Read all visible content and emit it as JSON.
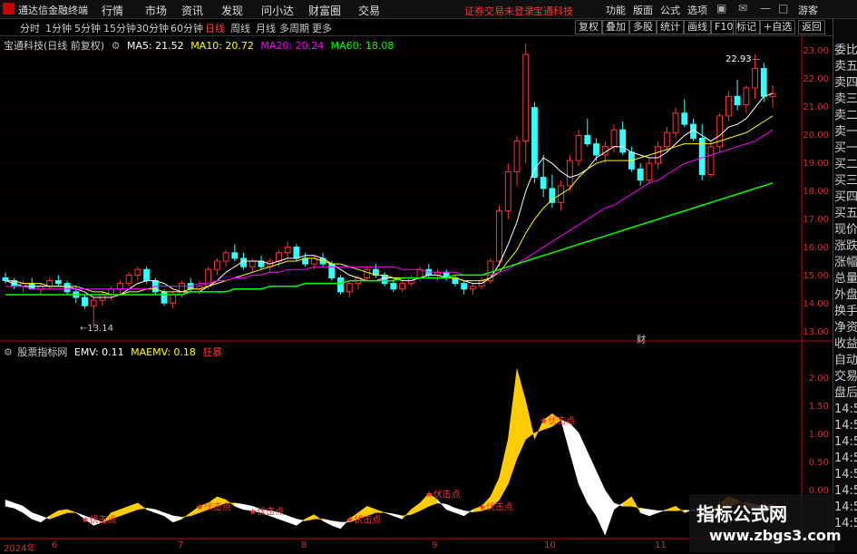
{
  "menubar": {
    "app_title": "通达信金融终端",
    "menu": [
      "行情",
      "市场",
      "资讯",
      "发现",
      "问小达",
      "财富圈",
      "交易"
    ],
    "notice": "证券交易未登录",
    "stock": "宝通科技",
    "right": [
      "功能",
      "版面",
      "公式",
      "选项"
    ],
    "user": "游客"
  },
  "tabs": {
    "periods": [
      "分时",
      "1分钟",
      "5分钟",
      "15分钟",
      "30分钟",
      "60分钟",
      "日线",
      "周线",
      "月线",
      "多周期",
      "更多"
    ],
    "active": "日线",
    "tools": [
      "复权",
      "叠加",
      "多股",
      "统计",
      "画线",
      "F10",
      "标记",
      "+自选",
      "返回"
    ]
  },
  "price_legend": {
    "name": "宝通科技(日线 前复权)",
    "ma5": "MA5: 21.52",
    "ma10": "MA10: 20.72",
    "ma20": "MA20: 20.24",
    "ma60": "MA60: 18.08"
  },
  "indicator_legend": {
    "name": "股票指标网",
    "emv": "EMV: 0.11",
    "maemv": "MAEMV: 0.18",
    "mode": "狂暴"
  },
  "price_axis": [
    "23.00",
    "22.00",
    "21.00",
    "20.00",
    "19.00",
    "18.00",
    "17.00",
    "16.00",
    "15.00",
    "14.00",
    "13.00"
  ],
  "indicator_axis": [
    "2.00",
    "1.50",
    "1.00",
    "0.50",
    "0.00"
  ],
  "annotations": {
    "high": "22.93",
    "low": "13.14",
    "cai": "财",
    "signal": "伏击点"
  },
  "x_axis": [
    "2024年",
    "6",
    "7",
    "8",
    "9",
    "10",
    "11"
  ],
  "right_panel": [
    "委比",
    "卖五",
    "卖四",
    "卖三",
    "卖二",
    "卖一",
    "买一",
    "买二",
    "买三",
    "买四",
    "买五",
    "现价",
    "涨跌",
    "涨幅",
    "总量",
    "外盘",
    "换手",
    "净资",
    "收益",
    "自动",
    "交易",
    "盘后",
    "14:5",
    "14:5",
    "14:5",
    "14:5",
    "14:5",
    "14:5",
    "14:5",
    "14:5"
  ],
  "watermark": {
    "line1": "指标公式网",
    "line2": "www.zbgs3.com"
  },
  "colors": {
    "up": "#ff3333",
    "down": "#33ffff",
    "ma5": "#ffffff",
    "ma10": "#ffff00",
    "ma20": "#ff00ff",
    "ma60": "#00ff00",
    "emv_fill": "#ffcc00",
    "maemv_fill": "#ffffff"
  },
  "chart_data": {
    "type": "candlestick",
    "price_range": [
      13.0,
      23.3
    ],
    "ohlc": [
      [
        14.9,
        15.1,
        14.7,
        14.8
      ],
      [
        14.8,
        14.9,
        14.5,
        14.6
      ],
      [
        14.6,
        14.8,
        14.4,
        14.7
      ],
      [
        14.7,
        14.9,
        14.5,
        14.5
      ],
      [
        14.5,
        14.7,
        14.3,
        14.6
      ],
      [
        14.6,
        14.9,
        14.5,
        14.8
      ],
      [
        14.8,
        15.0,
        14.6,
        14.7
      ],
      [
        14.7,
        14.8,
        14.3,
        14.4
      ],
      [
        14.4,
        14.6,
        14.0,
        14.2
      ],
      [
        14.2,
        14.3,
        13.8,
        13.9
      ],
      [
        13.9,
        14.2,
        13.1,
        14.1
      ],
      [
        14.1,
        14.4,
        13.9,
        14.3
      ],
      [
        14.3,
        14.6,
        14.1,
        14.5
      ],
      [
        14.5,
        14.8,
        14.3,
        14.7
      ],
      [
        14.7,
        15.1,
        14.6,
        15.0
      ],
      [
        15.0,
        15.3,
        14.8,
        15.2
      ],
      [
        15.2,
        15.3,
        14.7,
        14.8
      ],
      [
        14.8,
        14.9,
        14.3,
        14.4
      ],
      [
        14.4,
        14.5,
        13.9,
        14.0
      ],
      [
        14.0,
        14.4,
        13.8,
        14.3
      ],
      [
        14.3,
        14.8,
        14.2,
        14.7
      ],
      [
        14.7,
        14.9,
        14.4,
        14.5
      ],
      [
        14.5,
        14.8,
        14.3,
        14.6
      ],
      [
        14.6,
        15.3,
        14.5,
        15.2
      ],
      [
        15.2,
        15.6,
        15.0,
        15.5
      ],
      [
        15.5,
        15.9,
        15.3,
        15.8
      ],
      [
        15.8,
        16.1,
        15.5,
        15.6
      ],
      [
        15.6,
        15.8,
        15.2,
        15.3
      ],
      [
        15.3,
        15.6,
        15.1,
        15.5
      ],
      [
        15.5,
        15.7,
        15.2,
        15.3
      ],
      [
        15.3,
        15.6,
        15.1,
        15.5
      ],
      [
        15.5,
        15.9,
        15.3,
        15.8
      ],
      [
        15.8,
        16.2,
        15.6,
        16.0
      ],
      [
        16.0,
        16.1,
        15.5,
        15.6
      ],
      [
        15.6,
        15.8,
        15.3,
        15.4
      ],
      [
        15.4,
        15.7,
        15.2,
        15.6
      ],
      [
        15.6,
        15.8,
        15.3,
        15.4
      ],
      [
        15.4,
        15.5,
        14.8,
        14.9
      ],
      [
        14.9,
        15.0,
        14.3,
        14.4
      ],
      [
        14.4,
        14.8,
        14.2,
        14.7
      ],
      [
        14.7,
        15.0,
        14.5,
        14.9
      ],
      [
        14.9,
        15.3,
        14.8,
        15.2
      ],
      [
        15.2,
        15.4,
        14.9,
        15.0
      ],
      [
        15.0,
        15.1,
        14.6,
        14.7
      ],
      [
        14.7,
        14.9,
        14.4,
        14.5
      ],
      [
        14.5,
        14.8,
        14.4,
        14.7
      ],
      [
        14.7,
        15.0,
        14.6,
        14.9
      ],
      [
        14.9,
        15.3,
        14.8,
        15.2
      ],
      [
        15.2,
        15.4,
        14.9,
        15.0
      ],
      [
        15.0,
        15.2,
        14.8,
        15.1
      ],
      [
        15.1,
        15.2,
        14.8,
        14.9
      ],
      [
        14.9,
        15.0,
        14.6,
        14.7
      ],
      [
        14.7,
        14.8,
        14.3,
        14.5
      ],
      [
        14.5,
        14.7,
        14.3,
        14.6
      ],
      [
        14.6,
        14.9,
        14.5,
        14.8
      ],
      [
        14.8,
        15.6,
        14.7,
        15.5
      ],
      [
        15.5,
        17.5,
        15.3,
        17.3
      ],
      [
        17.3,
        19.0,
        17.0,
        18.7
      ],
      [
        18.7,
        20.0,
        18.2,
        19.8
      ],
      [
        19.8,
        23.3,
        19.0,
        22.9
      ],
      [
        21.0,
        21.2,
        18.3,
        18.5
      ],
      [
        18.5,
        19.3,
        17.8,
        18.1
      ],
      [
        18.1,
        18.6,
        17.4,
        17.6
      ],
      [
        17.6,
        18.4,
        17.3,
        18.2
      ],
      [
        18.2,
        19.3,
        18.0,
        19.1
      ],
      [
        19.1,
        20.2,
        18.9,
        20.0
      ],
      [
        20.0,
        20.6,
        19.6,
        19.7
      ],
      [
        19.7,
        19.9,
        19.1,
        19.3
      ],
      [
        19.3,
        19.8,
        19.0,
        19.6
      ],
      [
        19.6,
        20.4,
        19.4,
        20.2
      ],
      [
        20.2,
        20.5,
        19.3,
        19.4
      ],
      [
        19.4,
        19.6,
        18.7,
        18.8
      ],
      [
        18.8,
        19.0,
        18.2,
        18.4
      ],
      [
        18.4,
        19.2,
        18.3,
        19.0
      ],
      [
        19.0,
        19.8,
        18.8,
        19.6
      ],
      [
        19.6,
        20.3,
        19.4,
        20.1
      ],
      [
        20.1,
        21.0,
        19.9,
        20.8
      ],
      [
        20.8,
        21.3,
        20.3,
        20.4
      ],
      [
        20.4,
        20.6,
        19.8,
        19.9
      ],
      [
        19.9,
        20.4,
        18.4,
        18.6
      ],
      [
        18.6,
        19.8,
        18.5,
        19.6
      ],
      [
        19.6,
        20.8,
        19.4,
        20.7
      ],
      [
        20.7,
        21.6,
        20.5,
        21.4
      ],
      [
        21.4,
        22.0,
        20.9,
        21.1
      ],
      [
        21.1,
        21.8,
        20.8,
        21.7
      ],
      [
        21.7,
        22.9,
        21.3,
        22.4
      ],
      [
        22.4,
        22.6,
        21.2,
        21.4
      ],
      [
        21.4,
        21.8,
        21.0,
        21.5
      ]
    ],
    "ma_series": [
      {
        "name": "MA5",
        "values": [
          14.8,
          14.7,
          14.6,
          14.6,
          14.6,
          14.6,
          14.6,
          14.6,
          14.5,
          14.4,
          14.2,
          14.2,
          14.2,
          14.3,
          14.5,
          14.7,
          14.8,
          14.8,
          14.7,
          14.5,
          14.4,
          14.4,
          14.4,
          14.6,
          14.8,
          15.1,
          15.3,
          15.5,
          15.5,
          15.5,
          15.4,
          15.5,
          15.6,
          15.6,
          15.7,
          15.7,
          15.6,
          15.4,
          15.2,
          15.0,
          14.9,
          14.8,
          14.8,
          14.9,
          14.9,
          14.8,
          14.8,
          14.9,
          15.0,
          15.0,
          14.9,
          14.9,
          14.8,
          14.7,
          14.7,
          14.9,
          15.4,
          16.1,
          16.9,
          18.0,
          18.8,
          19.2,
          19.0,
          18.7,
          18.5,
          18.6,
          18.8,
          19.2,
          19.4,
          19.6,
          19.6,
          19.4,
          19.3,
          19.2,
          19.2,
          19.4,
          19.7,
          20.0,
          20.2,
          20.0,
          19.8,
          20.0,
          20.3,
          20.4,
          20.6,
          21.0,
          21.4,
          21.5
        ]
      },
      {
        "name": "MA10",
        "values": [
          14.8,
          14.8,
          14.7,
          14.7,
          14.7,
          14.6,
          14.6,
          14.6,
          14.6,
          14.5,
          14.4,
          14.4,
          14.3,
          14.3,
          14.4,
          14.4,
          14.5,
          14.5,
          14.4,
          14.4,
          14.4,
          14.5,
          14.5,
          14.6,
          14.7,
          14.8,
          14.9,
          15.0,
          15.1,
          15.2,
          15.3,
          15.4,
          15.5,
          15.5,
          15.6,
          15.6,
          15.5,
          15.4,
          15.4,
          15.3,
          15.2,
          15.1,
          15.0,
          15.0,
          14.9,
          14.9,
          14.9,
          14.9,
          14.9,
          14.9,
          14.9,
          14.9,
          14.8,
          14.8,
          14.8,
          14.9,
          15.1,
          15.5,
          15.9,
          16.5,
          17.0,
          17.4,
          17.7,
          17.9,
          18.1,
          18.5,
          18.8,
          19.0,
          19.1,
          19.1,
          19.1,
          19.1,
          19.2,
          19.3,
          19.4,
          19.5,
          19.6,
          19.7,
          19.7,
          19.7,
          19.7,
          19.8,
          19.9,
          20.0,
          20.1,
          20.3,
          20.5,
          20.7
        ]
      },
      {
        "name": "MA20",
        "values": [
          14.6,
          14.6,
          14.6,
          14.5,
          14.5,
          14.5,
          14.5,
          14.5,
          14.5,
          14.5,
          14.5,
          14.5,
          14.5,
          14.5,
          14.5,
          14.5,
          14.5,
          14.6,
          14.6,
          14.6,
          14.6,
          14.6,
          14.7,
          14.7,
          14.8,
          14.8,
          14.9,
          14.9,
          15.0,
          15.0,
          15.1,
          15.1,
          15.2,
          15.2,
          15.2,
          15.3,
          15.3,
          15.3,
          15.3,
          15.3,
          15.3,
          15.3,
          15.3,
          15.3,
          15.3,
          15.2,
          15.2,
          15.2,
          15.1,
          15.1,
          15.1,
          15.1,
          15.0,
          15.0,
          15.0,
          15.0,
          15.1,
          15.2,
          15.4,
          15.6,
          15.8,
          16.0,
          16.2,
          16.4,
          16.6,
          16.8,
          17.0,
          17.2,
          17.4,
          17.5,
          17.7,
          17.9,
          18.1,
          18.3,
          18.4,
          18.6,
          18.8,
          19.0,
          19.1,
          19.2,
          19.3,
          19.4,
          19.5,
          19.6,
          19.7,
          19.8,
          20.0,
          20.2
        ]
      },
      {
        "name": "MA60",
        "values": [
          14.3,
          14.3,
          14.3,
          14.3,
          14.3,
          14.3,
          14.3,
          14.3,
          14.3,
          14.3,
          14.3,
          14.3,
          14.3,
          14.3,
          14.3,
          14.3,
          14.3,
          14.3,
          14.3,
          14.3,
          14.3,
          14.4,
          14.4,
          14.4,
          14.4,
          14.4,
          14.5,
          14.5,
          14.5,
          14.5,
          14.6,
          14.6,
          14.6,
          14.6,
          14.7,
          14.7,
          14.7,
          14.7,
          14.7,
          14.8,
          14.8,
          14.8,
          14.8,
          14.8,
          14.8,
          14.9,
          14.9,
          14.9,
          14.9,
          14.9,
          14.9,
          15.0,
          15.0,
          15.0,
          15.0,
          15.1,
          15.2,
          15.3,
          15.4,
          15.5,
          15.6,
          15.7,
          15.8,
          15.9,
          16.0,
          16.1,
          16.2,
          16.3,
          16.4,
          16.5,
          16.6,
          16.7,
          16.8,
          16.9,
          17.0,
          17.1,
          17.2,
          17.3,
          17.4,
          17.5,
          17.6,
          17.7,
          17.8,
          17.9,
          18.0,
          18.1,
          18.2,
          18.3
        ]
      }
    ],
    "indicator": {
      "range": [
        -0.3,
        2.4
      ],
      "emv": [
        0.15,
        0.12,
        0.05,
        -0.05,
        -0.1,
        0.0,
        0.08,
        0.1,
        0.05,
        -0.05,
        -0.15,
        -0.1,
        0.05,
        0.1,
        0.15,
        0.2,
        0.1,
        0.05,
        0.0,
        -0.1,
        -0.05,
        0.05,
        0.15,
        0.2,
        0.3,
        0.25,
        0.15,
        0.1,
        0.08,
        0.05,
        0.0,
        -0.05,
        -0.1,
        -0.15,
        -0.05,
        0.02,
        -0.08,
        -0.15,
        -0.2,
        -0.05,
        0.05,
        0.15,
        0.1,
        0.05,
        0.0,
        -0.05,
        0.1,
        0.2,
        0.35,
        0.25,
        0.1,
        0.05,
        0.0,
        0.1,
        0.15,
        0.3,
        0.6,
        1.2,
        2.3,
        1.8,
        1.2,
        1.5,
        1.6,
        1.5,
        1.0,
        0.5,
        0.2,
        0.0,
        -0.3,
        0.1,
        0.2,
        0.3,
        0.05,
        0.0,
        0.05,
        0.1,
        0.15,
        0.05,
        0.1,
        0.0,
        0.05,
        0.2,
        0.3,
        0.25,
        0.15,
        0.1,
        0.05,
        0.11
      ],
      "maemv": [
        0.25,
        0.2,
        0.15,
        0.05,
        0.0,
        -0.05,
        0.0,
        0.05,
        0.05,
        0.0,
        -0.05,
        -0.1,
        -0.05,
        0.0,
        0.05,
        0.1,
        0.12,
        0.1,
        0.05,
        0.0,
        -0.02,
        0.0,
        0.05,
        0.1,
        0.15,
        0.2,
        0.2,
        0.18,
        0.15,
        0.1,
        0.08,
        0.05,
        0.0,
        -0.05,
        -0.08,
        -0.05,
        -0.05,
        -0.08,
        -0.1,
        -0.1,
        -0.05,
        0.0,
        0.05,
        0.05,
        0.03,
        0.0,
        0.02,
        0.08,
        0.15,
        0.2,
        0.18,
        0.12,
        0.08,
        0.06,
        0.08,
        0.12,
        0.25,
        0.5,
        0.9,
        1.2,
        1.3,
        1.35,
        1.4,
        1.5,
        1.45,
        1.3,
        1.0,
        0.7,
        0.4,
        0.2,
        0.15,
        0.15,
        0.12,
        0.1,
        0.08,
        0.08,
        0.08,
        0.09,
        0.08,
        0.07,
        0.07,
        0.1,
        0.15,
        0.2,
        0.2,
        0.18,
        0.15,
        0.18
      ]
    },
    "signals": [
      9,
      22,
      28,
      39,
      48,
      54,
      61,
      81,
      84
    ]
  }
}
